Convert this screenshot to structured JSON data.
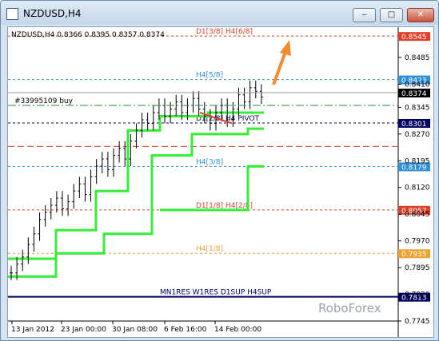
{
  "window": {
    "title": "NZDUSD,H4",
    "minimize_label": "‒",
    "maximize_label": "□",
    "close_label": "✕"
  },
  "chart": {
    "info": "NZDUSD,H4  0.8366 0.8395 0.8357 0.8374",
    "watermark": "RoboForex",
    "order_label": "#33995109 buy",
    "colors": {
      "up": "#000000",
      "candle": "#000000",
      "level_green": "#33ee33",
      "arrow": "#f28a2e",
      "baseline": "#000060"
    }
  },
  "chart_data": {
    "type": "line",
    "title": "NZDUSD,H4",
    "ylim": [
      0.7745,
      0.857
    ],
    "y_ticks": [
      0.8485,
      0.841,
      0.8345,
      0.827,
      0.8195,
      0.812,
      0.8045,
      0.797,
      0.7895,
      0.782,
      0.7745
    ],
    "x_tick_labels": [
      "13 Jan 2012",
      "23 Jan 00:00",
      "30 Jan 08:00",
      "6 Feb 16:00",
      "14 Feb 00:00"
    ],
    "levels": [
      {
        "label": "D1[3/8] H4[6/8]",
        "value": 0.8545,
        "color": "#e0402a",
        "tag": "0.8545"
      },
      {
        "label": "H4[5/8]",
        "value": 0.8423,
        "color": "#2f8fd8",
        "tag": "0.8423"
      },
      {
        "label": "D1[2/8] H4 PIVOT",
        "value": 0.8301,
        "color": "#000060",
        "tag": "0.8301"
      },
      {
        "label": "H4[3/8]",
        "value": 0.8179,
        "color": "#2f8fd8",
        "tag": "0.8179"
      },
      {
        "label": "D1[1/8] H4[2/8]",
        "value": 0.8057,
        "color": "#e0402a",
        "tag": "0.8057"
      },
      {
        "label": "H4[1/8]",
        "value": 0.7935,
        "color": "#f0a030",
        "tag": "0.7935"
      },
      {
        "label": "MN1RES W1RES D1SUP H4SUP",
        "value": 0.7813,
        "color": "#000060",
        "tag": "0.7813"
      }
    ],
    "current_price": 0.8374,
    "order_price": 0.8345,
    "mid_dashed": 0.8235,
    "price_close": [
      0.788,
      0.7905,
      0.7925,
      0.796,
      0.799,
      0.803,
      0.805,
      0.807,
      0.809,
      0.806,
      0.808,
      0.811,
      0.813,
      0.81,
      0.815,
      0.818,
      0.82,
      0.817,
      0.821,
      0.823,
      0.82,
      0.825,
      0.828,
      0.831,
      0.83,
      0.833,
      0.835,
      0.832,
      0.834,
      0.836,
      0.833,
      0.835,
      0.837,
      0.834,
      0.832,
      0.83,
      0.833,
      0.835,
      0.831,
      0.834,
      0.838,
      0.836,
      0.84,
      0.839,
      0.8374
    ],
    "green_step_series": [
      0.784,
      0.787,
      0.79,
      0.795,
      0.8,
      0.81,
      0.815,
      0.82,
      0.825,
      0.828,
      0.829,
      0.831,
      0.833
    ],
    "green_steps": [
      [
        [
          0,
          0.787
        ],
        [
          60,
          0.787
        ],
        [
          60,
          0.7935
        ],
        [
          120,
          0.7935
        ],
        [
          120,
          0.799
        ],
        [
          180,
          0.799
        ],
        [
          180,
          0.821
        ],
        [
          230,
          0.821
        ],
        [
          230,
          0.827
        ],
        [
          300,
          0.827
        ],
        [
          300,
          0.8285
        ],
        [
          320,
          0.8285
        ]
      ],
      [
        [
          0,
          0.792
        ],
        [
          60,
          0.792
        ],
        [
          60,
          0.8
        ],
        [
          110,
          0.8
        ],
        [
          110,
          0.811
        ],
        [
          150,
          0.811
        ],
        [
          150,
          0.828
        ],
        [
          190,
          0.828
        ],
        [
          190,
          0.832
        ],
        [
          250,
          0.832
        ],
        [
          250,
          0.833
        ],
        [
          320,
          0.833
        ]
      ],
      [
        [
          190,
          0.8057
        ],
        [
          300,
          0.8057
        ],
        [
          300,
          0.8179
        ],
        [
          320,
          0.8179
        ]
      ]
    ]
  }
}
